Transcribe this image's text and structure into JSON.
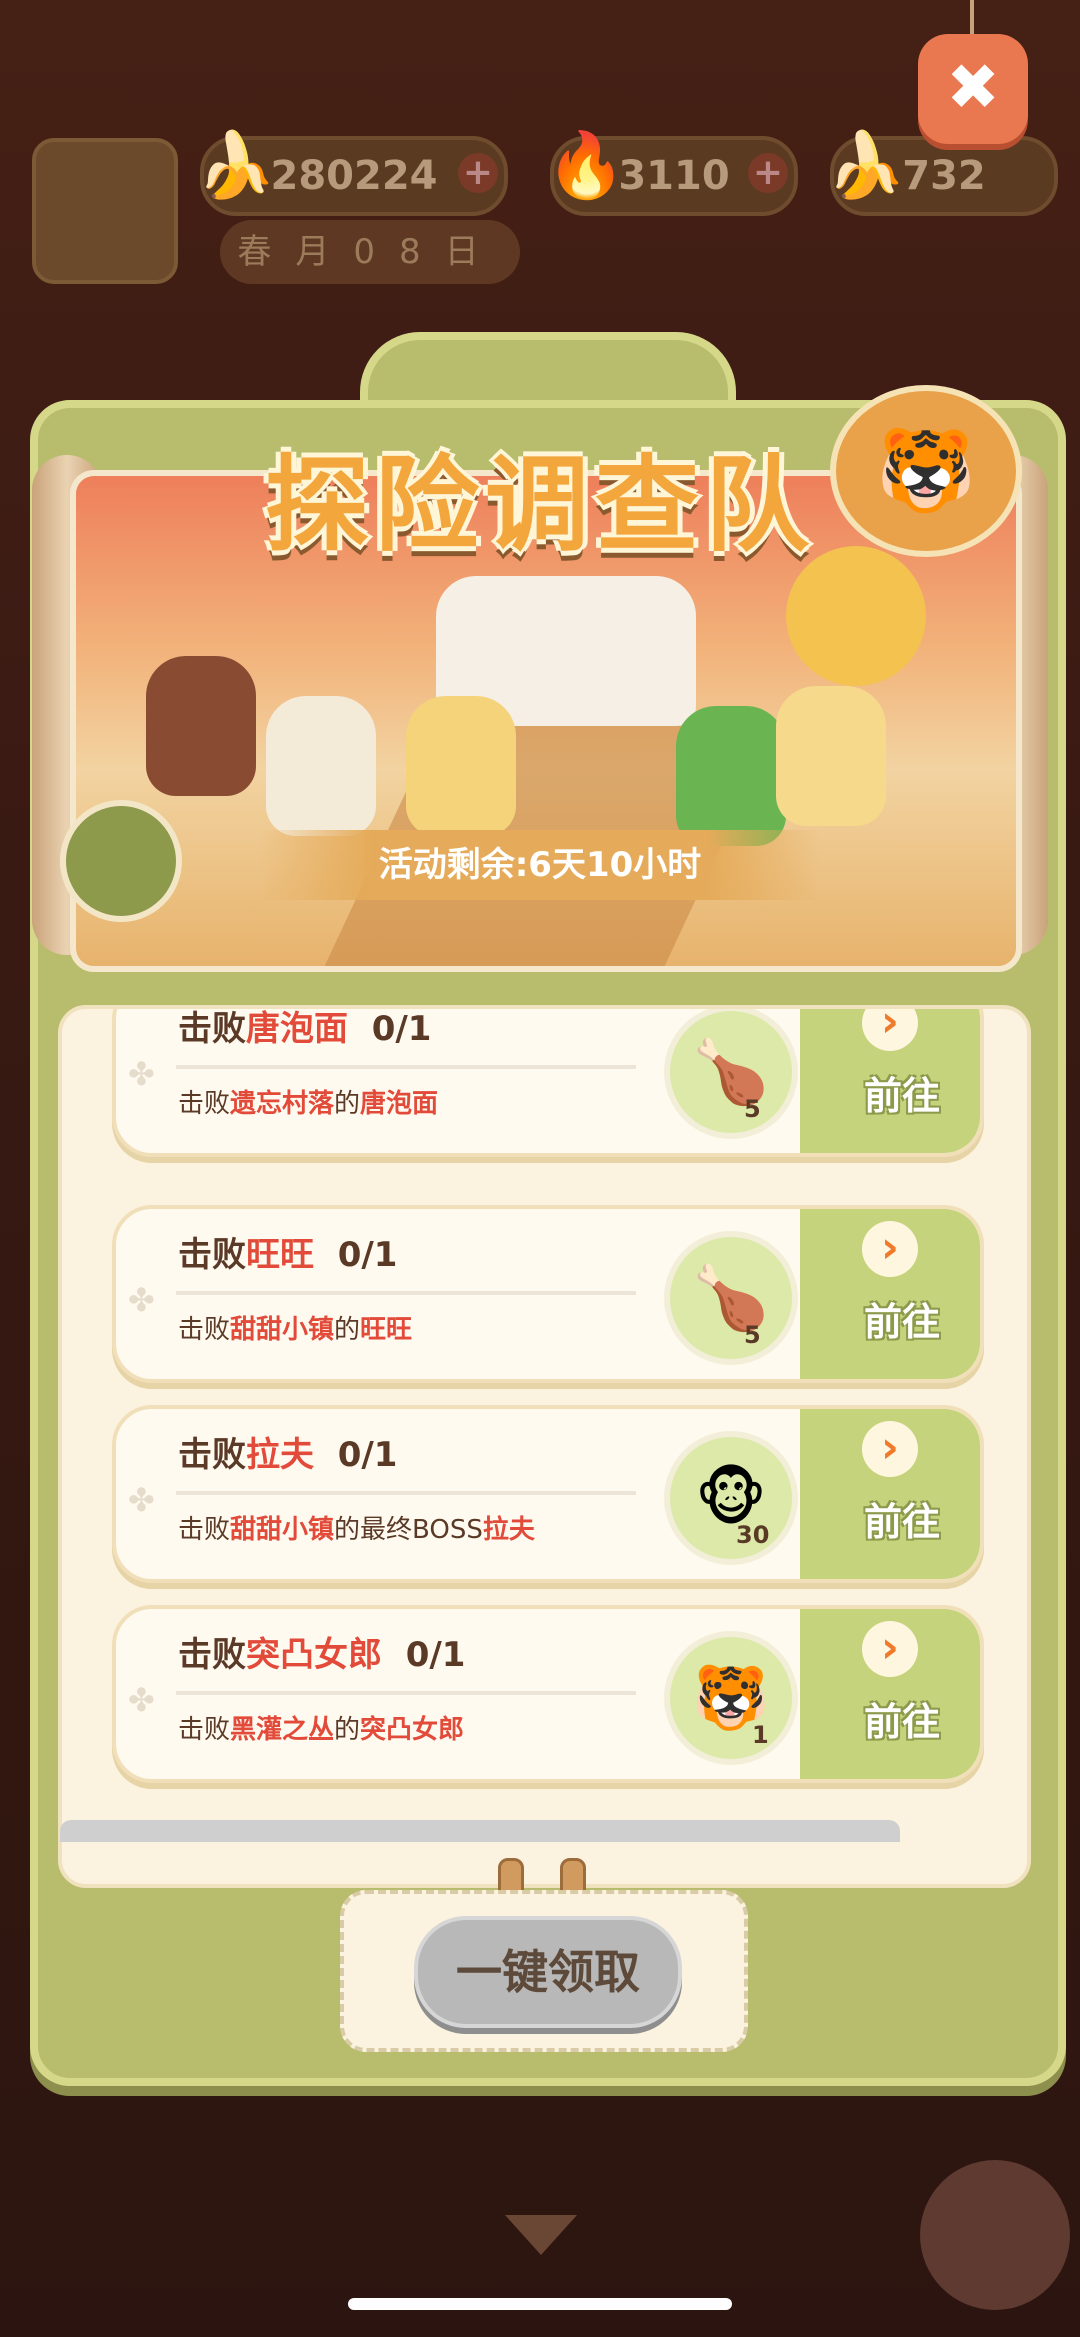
{
  "resources": {
    "banana": {
      "value": "280224",
      "icon": "banana-icon"
    },
    "blue_flame": {
      "value": "3110",
      "icon": "flame-icon"
    },
    "blue_banana": {
      "value": "732",
      "icon": "blue-banana-icon"
    },
    "date": "春月08日"
  },
  "event": {
    "title": "探险调查队",
    "timer": "活动剩余:6天10小时"
  },
  "tasks": [
    {
      "prefix": "击败",
      "target": "唐泡面",
      "progress": "0/1",
      "sub_prefix": "击败",
      "location": "遗忘村落",
      "sub_mid": "的",
      "sub_target": "唐泡面",
      "reward_icon": "paw-icon",
      "reward_count": "5",
      "go_label": "前往"
    },
    {
      "prefix": "击败",
      "target": "旺旺",
      "progress": "0/1",
      "sub_prefix": "击败",
      "location": "甜甜小镇",
      "sub_mid": "的",
      "sub_target": "旺旺",
      "reward_icon": "paw-icon",
      "reward_count": "5",
      "go_label": "前往"
    },
    {
      "prefix": "击败",
      "target": "拉夫",
      "progress": "0/1",
      "sub_prefix": "击败",
      "location": "甜甜小镇",
      "sub_mid": "的最终BOSS",
      "sub_target": "拉夫",
      "reward_icon": "monkey-icon",
      "reward_count": "30",
      "go_label": "前往"
    },
    {
      "prefix": "击败",
      "target": "突凸女郎",
      "progress": "0/1",
      "sub_prefix": "击败",
      "location": "黑灌之丛",
      "sub_mid": "的",
      "sub_target": "突凸女郎",
      "reward_icon": "tiger-icon",
      "reward_count": "1",
      "go_label": "前往"
    }
  ],
  "claim_all": "一键领取",
  "close_label": "✖",
  "plus": "+"
}
